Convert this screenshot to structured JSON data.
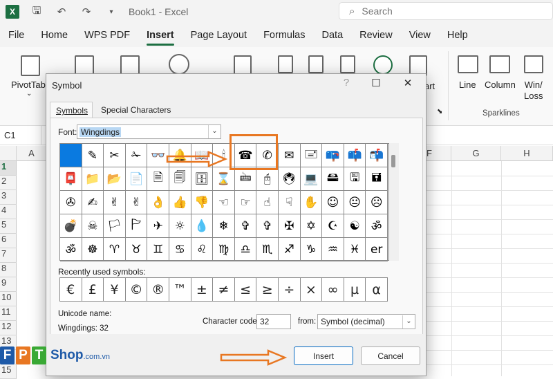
{
  "titlebar": {
    "title": "Book1  -  Excel",
    "search_placeholder": "Search",
    "logo": "X"
  },
  "menu": [
    "File",
    "Home",
    "WPS PDF",
    "Insert",
    "Page Layout",
    "Formulas",
    "Data",
    "Review",
    "View",
    "Help"
  ],
  "ribbon": {
    "pivot": "PivotTable",
    "art": "art",
    "line": "Line",
    "column": "Column",
    "winloss": "Win/\nLoss",
    "sparklines": "Sparklines"
  },
  "namebox": "C1",
  "columns": [
    "A",
    "F",
    "G",
    "H"
  ],
  "rows": [
    "1",
    "2",
    "3",
    "4",
    "5",
    "6",
    "7",
    "8",
    "9",
    "10",
    "11",
    "12",
    "13",
    "14",
    "15"
  ],
  "dialog": {
    "title": "Symbol",
    "tabs": [
      "Symbols",
      "Special Characters"
    ],
    "font_label": "Font:",
    "font_value": "Wingdings",
    "symbols": [
      [
        "",
        "✎",
        "✂",
        "✁",
        "👓",
        "🔔",
        "📖",
        "🕯",
        "☎",
        "✆",
        "✉",
        "🖃",
        "📪",
        "📫",
        "📬"
      ],
      [
        "📮",
        "📁",
        "📂",
        "📄",
        "🗎",
        "🗐",
        "🗄",
        "⌛",
        "🖮",
        "🖰",
        "🖲",
        "💻",
        "🖴",
        "🖫",
        "🖬"
      ],
      [
        "✇",
        "✍",
        "✌",
        "✌",
        "👌",
        "👍",
        "👎",
        "☜",
        "☞",
        "☝",
        "☟",
        "✋",
        "☺",
        "😐",
        "☹"
      ],
      [
        "💣",
        "☠",
        "🏳",
        "🏱",
        "✈",
        "☼",
        "💧",
        "❄",
        "✞",
        "✞",
        "✠",
        "✡",
        "☪",
        "☯",
        "ॐ"
      ],
      [
        "ॐ",
        "☸",
        "♈",
        "♉",
        "♊",
        "♋",
        "♌",
        "♍",
        "♎",
        "♏",
        "♐",
        "♑",
        "♒",
        "♓",
        "er"
      ]
    ],
    "recent_label": "Recently used symbols:",
    "recent": [
      "€",
      "£",
      "¥",
      "©",
      "®",
      "™",
      "±",
      "≠",
      "≤",
      "≥",
      "÷",
      "×",
      "∞",
      "µ",
      "α"
    ],
    "unicode_name_label": "Unicode name:",
    "unicode_value": "Wingdings: 32",
    "char_code_label": "Character code:",
    "char_code": "32",
    "from_label": "from:",
    "from_value": "Symbol (decimal)",
    "insert": "Insert",
    "cancel": "Cancel"
  },
  "watermark": {
    "letters": [
      "F",
      "P",
      "T"
    ],
    "shop": "Shop",
    "domain": ".com.vn"
  },
  "colors": {
    "excel_green": "#1d6f42",
    "highlight_orange": "#e87722",
    "selected_cell": "#0a7ae0"
  }
}
